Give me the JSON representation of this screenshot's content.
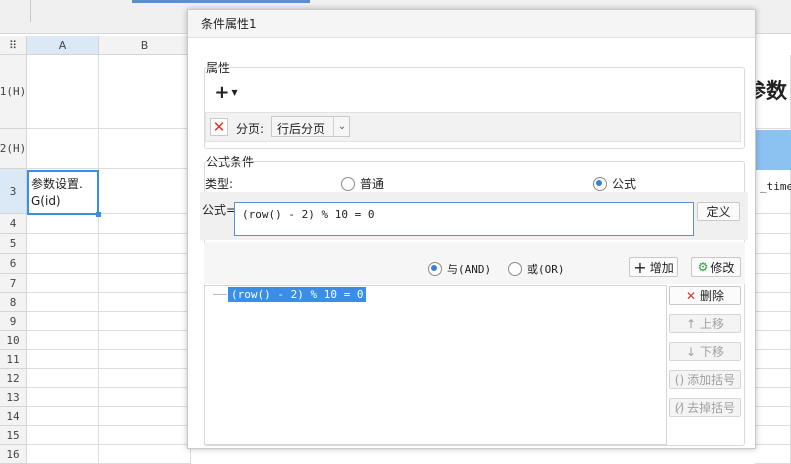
{
  "sheet": {
    "columns": [
      "A",
      "B"
    ],
    "rows": [
      "1(H)",
      "2(H)",
      "3",
      "4",
      "5",
      "6",
      "7",
      "8",
      "9",
      "10",
      "11",
      "12",
      "13",
      "14",
      "15",
      "16"
    ],
    "selected_cell_text": "参数设置.\nG(id)",
    "right_header_text": "参数",
    "right_cell_text": "_time"
  },
  "dialog": {
    "title": "条件属性1",
    "property_group_label": "属性",
    "add_button_label": "+",
    "paging_label": "分页:",
    "paging_value": "行后分页",
    "formula_group_label": "公式条件",
    "type_label": "类型:",
    "type_options": [
      "普通",
      "公式"
    ],
    "type_selected": "公式",
    "formula_label": "公式=",
    "formula_value": "(row() - 2) % 10 = 0",
    "define_button": "定义",
    "logic_options": [
      "与(AND)",
      "或(OR)"
    ],
    "logic_selected": "与(AND)",
    "add_condition_button": "增加",
    "modify_button": "修改",
    "conditions": [
      "(row() - 2) % 10 = 0"
    ],
    "side_buttons": [
      "删除",
      "上移",
      "下移",
      "添加括号",
      "去掉括号"
    ]
  },
  "colors": {
    "accent": "#3a7fd6",
    "selection": "#3a8ee6",
    "delete_red": "#d9342b"
  }
}
